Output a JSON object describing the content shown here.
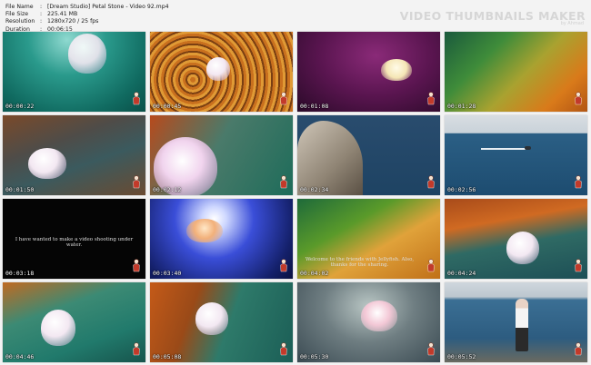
{
  "meta": {
    "rows": [
      {
        "key": "File Name",
        "value": "[Dream Studio] Petal Stone - Video 92.mp4"
      },
      {
        "key": "File Size",
        "value": "225.41 MB"
      },
      {
        "key": "Resolution",
        "value": "1280x720 / 25 fps"
      },
      {
        "key": "Duration",
        "value": "00:06:15"
      }
    ]
  },
  "brand": {
    "title": "VIDEO THUMBNAILS MAKER",
    "subtitle": "by Ahmad"
  },
  "thumbnails": [
    {
      "time": "00:00:22",
      "scene": "jelly-teal"
    },
    {
      "time": "00:00:45",
      "scene": "jelly-seaweed"
    },
    {
      "time": "00:01:08",
      "scene": "jelly-purple"
    },
    {
      "time": "00:01:28",
      "scene": "seaweed-light"
    },
    {
      "time": "00:01:50",
      "scene": "jelly-rocks"
    },
    {
      "time": "00:02:12",
      "scene": "jelly-close"
    },
    {
      "time": "00:02:34",
      "scene": "rock-sea"
    },
    {
      "time": "00:02:56",
      "scene": "boat-sea"
    },
    {
      "time": "00:03:18",
      "scene": "black-caption",
      "caption": "I have wanted to make a video shooting under water."
    },
    {
      "time": "00:03:40",
      "scene": "jelly-sunburst"
    },
    {
      "time": "00:04:02",
      "scene": "seaweed-caption",
      "caption": "Welcome to the friends with Jellyfish. Also, thanks for the sharing."
    },
    {
      "time": "00:04:24",
      "scene": "jelly-orange"
    },
    {
      "time": "00:04:46",
      "scene": "jelly-teal2"
    },
    {
      "time": "00:05:08",
      "scene": "jelly-seaweed2"
    },
    {
      "time": "00:05:30",
      "scene": "jelly-light"
    },
    {
      "time": "00:05:52",
      "scene": "girl-shore"
    }
  ],
  "colors": {
    "background": "#f3f3f3",
    "brand": "#d6d6d6",
    "timestamp": "#ffffff"
  }
}
